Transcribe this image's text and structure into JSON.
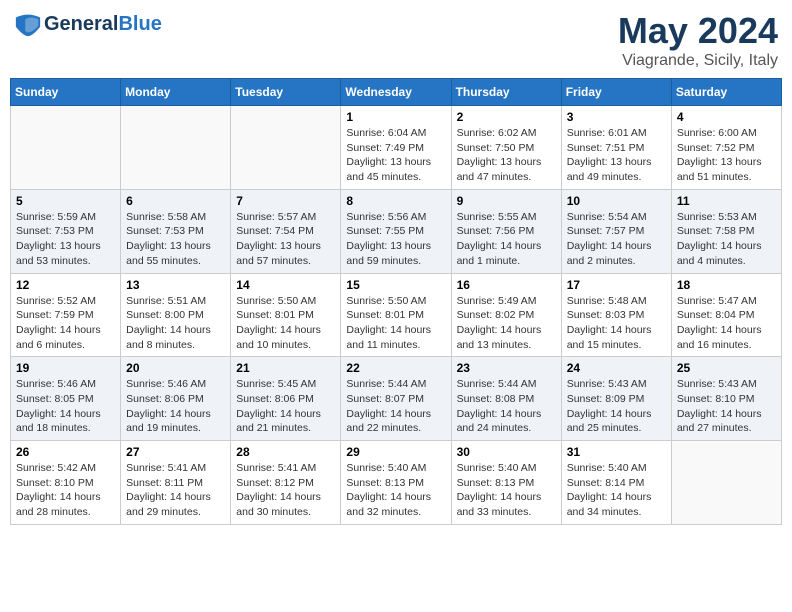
{
  "header": {
    "logo_line1": "General",
    "logo_line2": "Blue",
    "month": "May 2024",
    "location": "Viagrande, Sicily, Italy"
  },
  "days_of_week": [
    "Sunday",
    "Monday",
    "Tuesday",
    "Wednesday",
    "Thursday",
    "Friday",
    "Saturday"
  ],
  "weeks": [
    [
      {
        "day": "",
        "info": ""
      },
      {
        "day": "",
        "info": ""
      },
      {
        "day": "",
        "info": ""
      },
      {
        "day": "1",
        "info": "Sunrise: 6:04 AM\nSunset: 7:49 PM\nDaylight: 13 hours and 45 minutes."
      },
      {
        "day": "2",
        "info": "Sunrise: 6:02 AM\nSunset: 7:50 PM\nDaylight: 13 hours and 47 minutes."
      },
      {
        "day": "3",
        "info": "Sunrise: 6:01 AM\nSunset: 7:51 PM\nDaylight: 13 hours and 49 minutes."
      },
      {
        "day": "4",
        "info": "Sunrise: 6:00 AM\nSunset: 7:52 PM\nDaylight: 13 hours and 51 minutes."
      }
    ],
    [
      {
        "day": "5",
        "info": "Sunrise: 5:59 AM\nSunset: 7:53 PM\nDaylight: 13 hours and 53 minutes."
      },
      {
        "day": "6",
        "info": "Sunrise: 5:58 AM\nSunset: 7:53 PM\nDaylight: 13 hours and 55 minutes."
      },
      {
        "day": "7",
        "info": "Sunrise: 5:57 AM\nSunset: 7:54 PM\nDaylight: 13 hours and 57 minutes."
      },
      {
        "day": "8",
        "info": "Sunrise: 5:56 AM\nSunset: 7:55 PM\nDaylight: 13 hours and 59 minutes."
      },
      {
        "day": "9",
        "info": "Sunrise: 5:55 AM\nSunset: 7:56 PM\nDaylight: 14 hours and 1 minute."
      },
      {
        "day": "10",
        "info": "Sunrise: 5:54 AM\nSunset: 7:57 PM\nDaylight: 14 hours and 2 minutes."
      },
      {
        "day": "11",
        "info": "Sunrise: 5:53 AM\nSunset: 7:58 PM\nDaylight: 14 hours and 4 minutes."
      }
    ],
    [
      {
        "day": "12",
        "info": "Sunrise: 5:52 AM\nSunset: 7:59 PM\nDaylight: 14 hours and 6 minutes."
      },
      {
        "day": "13",
        "info": "Sunrise: 5:51 AM\nSunset: 8:00 PM\nDaylight: 14 hours and 8 minutes."
      },
      {
        "day": "14",
        "info": "Sunrise: 5:50 AM\nSunset: 8:01 PM\nDaylight: 14 hours and 10 minutes."
      },
      {
        "day": "15",
        "info": "Sunrise: 5:50 AM\nSunset: 8:01 PM\nDaylight: 14 hours and 11 minutes."
      },
      {
        "day": "16",
        "info": "Sunrise: 5:49 AM\nSunset: 8:02 PM\nDaylight: 14 hours and 13 minutes."
      },
      {
        "day": "17",
        "info": "Sunrise: 5:48 AM\nSunset: 8:03 PM\nDaylight: 14 hours and 15 minutes."
      },
      {
        "day": "18",
        "info": "Sunrise: 5:47 AM\nSunset: 8:04 PM\nDaylight: 14 hours and 16 minutes."
      }
    ],
    [
      {
        "day": "19",
        "info": "Sunrise: 5:46 AM\nSunset: 8:05 PM\nDaylight: 14 hours and 18 minutes."
      },
      {
        "day": "20",
        "info": "Sunrise: 5:46 AM\nSunset: 8:06 PM\nDaylight: 14 hours and 19 minutes."
      },
      {
        "day": "21",
        "info": "Sunrise: 5:45 AM\nSunset: 8:06 PM\nDaylight: 14 hours and 21 minutes."
      },
      {
        "day": "22",
        "info": "Sunrise: 5:44 AM\nSunset: 8:07 PM\nDaylight: 14 hours and 22 minutes."
      },
      {
        "day": "23",
        "info": "Sunrise: 5:44 AM\nSunset: 8:08 PM\nDaylight: 14 hours and 24 minutes."
      },
      {
        "day": "24",
        "info": "Sunrise: 5:43 AM\nSunset: 8:09 PM\nDaylight: 14 hours and 25 minutes."
      },
      {
        "day": "25",
        "info": "Sunrise: 5:43 AM\nSunset: 8:10 PM\nDaylight: 14 hours and 27 minutes."
      }
    ],
    [
      {
        "day": "26",
        "info": "Sunrise: 5:42 AM\nSunset: 8:10 PM\nDaylight: 14 hours and 28 minutes."
      },
      {
        "day": "27",
        "info": "Sunrise: 5:41 AM\nSunset: 8:11 PM\nDaylight: 14 hours and 29 minutes."
      },
      {
        "day": "28",
        "info": "Sunrise: 5:41 AM\nSunset: 8:12 PM\nDaylight: 14 hours and 30 minutes."
      },
      {
        "day": "29",
        "info": "Sunrise: 5:40 AM\nSunset: 8:13 PM\nDaylight: 14 hours and 32 minutes."
      },
      {
        "day": "30",
        "info": "Sunrise: 5:40 AM\nSunset: 8:13 PM\nDaylight: 14 hours and 33 minutes."
      },
      {
        "day": "31",
        "info": "Sunrise: 5:40 AM\nSunset: 8:14 PM\nDaylight: 14 hours and 34 minutes."
      },
      {
        "day": "",
        "info": ""
      }
    ]
  ]
}
